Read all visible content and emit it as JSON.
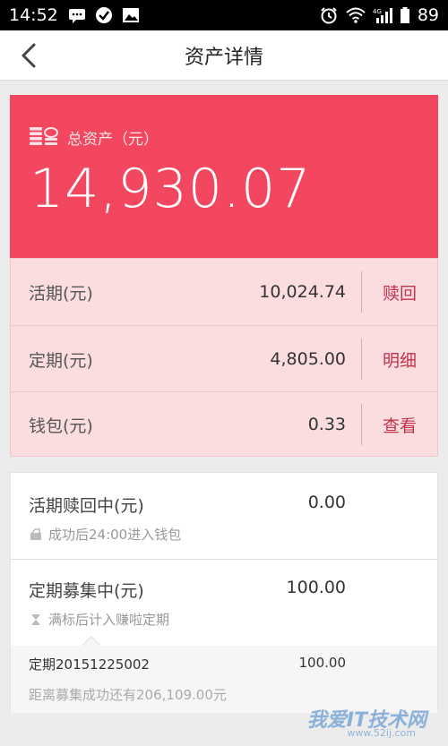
{
  "status_bar": {
    "time": "14:52",
    "battery": "89",
    "network": "4G"
  },
  "header": {
    "title": "资产详情"
  },
  "total_assets": {
    "label": "总资产（元）",
    "amount": "14,930.07"
  },
  "accounts": [
    {
      "label": "活期(元)",
      "value": "10,024.74",
      "action": "赎回"
    },
    {
      "label": "定期(元)",
      "value": "4,805.00",
      "action": "明细"
    },
    {
      "label": "钱包(元)",
      "value": "0.33",
      "action": "查看"
    }
  ],
  "pending": {
    "redeeming": {
      "title": "活期赎回中(元)",
      "value": "0.00",
      "note": "成功后24:00进入钱包"
    },
    "raising": {
      "title": "定期募集中(元)",
      "value": "100.00",
      "note": "满标后计入赚啦定期"
    },
    "detail": {
      "name": "定期20151225002",
      "value": "100.00",
      "note": "距离募集成功还有206,109.00元"
    }
  },
  "watermark": {
    "text": "我爱IT技术网",
    "url": "www.52ij.com"
  },
  "colors": {
    "hero": "#f2475f",
    "rows_bg": "#fbdde0",
    "action": "#c2334a"
  }
}
